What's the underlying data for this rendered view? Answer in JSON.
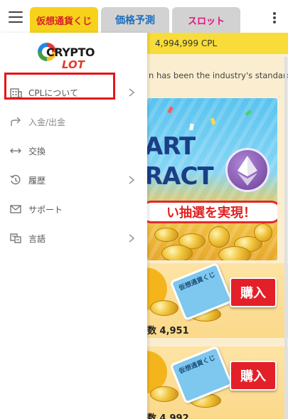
{
  "header": {
    "tabs": [
      {
        "label": "仮想通貨くじ",
        "active": true
      },
      {
        "label": "価格予測",
        "active": false
      },
      {
        "label": "スロット",
        "active": false
      }
    ]
  },
  "balance_bar": {
    "value": "4,994,999 CPL"
  },
  "description": "n has been the industry's standard",
  "banner": {
    "line1": "ART",
    "line2": "RACT",
    "tagline": "い抽選を実現！"
  },
  "lottery_cards": [
    {
      "ticket_text": "仮想通貨くじ",
      "buy_label": "購入",
      "count_text": "数 4,951"
    },
    {
      "ticket_text": "仮想通貨くじ",
      "buy_label": "購入",
      "count_text": "数 4,992"
    }
  ],
  "drawer": {
    "logo": {
      "line1": "CRYPTO",
      "line2": "LOT"
    },
    "menu": [
      {
        "label": "CPLについて",
        "icon": "building-icon",
        "chevron": true
      },
      {
        "label": "入金/出金",
        "icon": "share-arrow-icon",
        "chevron": false,
        "highlighted": true
      },
      {
        "label": "交換",
        "icon": "swap-arrows-icon",
        "chevron": false
      },
      {
        "label": "履歴",
        "icon": "history-icon",
        "chevron": true
      },
      {
        "label": "サポート",
        "icon": "mail-icon",
        "chevron": false
      },
      {
        "label": "言語",
        "icon": "translate-icon",
        "chevron": true
      }
    ]
  },
  "colors": {
    "accent_yellow": "#f6d21b",
    "highlight_red": "#e8141b",
    "buy_red": "#e32028"
  }
}
